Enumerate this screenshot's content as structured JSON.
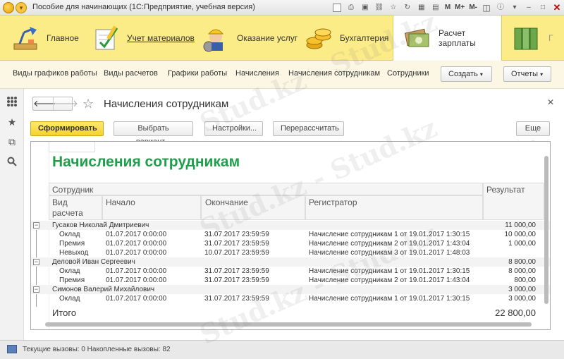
{
  "window": {
    "title": "Пособие для начинающих  (1С:Предприятие, учебная версия)",
    "toolbar_texts": [
      "M",
      "M+",
      "M-"
    ]
  },
  "sections": [
    {
      "label": "Главное",
      "icon": "desk-lamp-icon"
    },
    {
      "label": "Учет материалов",
      "icon": "pencil-check-icon"
    },
    {
      "label": "Оказание услуг",
      "icon": "worker-icon"
    },
    {
      "label": "Бухгалтерия",
      "icon": "coins-icon"
    },
    {
      "label": "Расчет зарплаты",
      "icon": "cash-icon"
    },
    {
      "label": "Г",
      "icon": "folders-icon"
    }
  ],
  "function_panel": {
    "items": [
      "Виды графиков работы",
      "Виды расчетов",
      "Графики работы",
      "Начисления",
      "Начисления сотрудникам",
      "Сотрудники"
    ],
    "create_label": "Создать",
    "reports_label": "Отчеты"
  },
  "form": {
    "title": "Начисления сотрудникам",
    "buttons": {
      "generate": "Сформировать",
      "choose_variant": "Выбрать вариант...",
      "settings": "Настройки...",
      "recalculate": "Перерассчитать",
      "more": "Еще"
    }
  },
  "report": {
    "title": "Начисления сотрудникам",
    "headers": {
      "employee": "Сотрудник",
      "calc_type_1": "Вид",
      "calc_type_2": "расчета",
      "start": "Начало",
      "end": "Окончание",
      "registrar": "Регистратор",
      "result": "Результат"
    },
    "groups": [
      {
        "employee": "Гусаков Николай Дмитриевич",
        "total": "11 000,00",
        "rows": [
          {
            "type": "Оклад",
            "start": "01.07.2017 0:00:00",
            "end": "31.07.2017 23:59:59",
            "registrar": "Начисление сотрудникам 1 от 19.01.2017 1:30:15",
            "result": "10 000,00"
          },
          {
            "type": "Премия",
            "start": "01.07.2017 0:00:00",
            "end": "31.07.2017 23:59:59",
            "registrar": "Начисление сотрудникам 2 от 19.01.2017 1:43:04",
            "result": "1 000,00"
          },
          {
            "type": "Невыход",
            "start": "01.07.2017 0:00:00",
            "end": "10.07.2017 23:59:59",
            "registrar": "Начисление сотрудникам 3 от 19.01.2017 1:48:03",
            "result": ""
          }
        ]
      },
      {
        "employee": "Деловой Иван Сергеевич",
        "total": "8 800,00",
        "rows": [
          {
            "type": "Оклад",
            "start": "01.07.2017 0:00:00",
            "end": "31.07.2017 23:59:59",
            "registrar": "Начисление сотрудникам 1 от 19.01.2017 1:30:15",
            "result": "8 000,00"
          },
          {
            "type": "Премия",
            "start": "01.07.2017 0:00:00",
            "end": "31.07.2017 23:59:59",
            "registrar": "Начисление сотрудникам 2 от 19.01.2017 1:43:04",
            "result": "800,00"
          }
        ]
      },
      {
        "employee": "Симонов Валерий Михайлович",
        "total": "3 000,00",
        "rows": [
          {
            "type": "Оклад",
            "start": "01.07.2017 0:00:00",
            "end": "31.07.2017 23:59:59",
            "registrar": "Начисление сотрудникам 1 от 19.01.2017 1:30:15",
            "result": "3 000,00"
          }
        ]
      }
    ],
    "total_label": "Итого",
    "total_value": "22 800,00"
  },
  "status": {
    "text": "Текущие вызовы: 0   Накопленные вызовы: 82"
  },
  "watermark": "Stud.kz - Stud.kz",
  "colors": {
    "sections_bg": "#fbec88",
    "report_title": "#1f9f4c",
    "primary_button": "#f5d22e"
  }
}
